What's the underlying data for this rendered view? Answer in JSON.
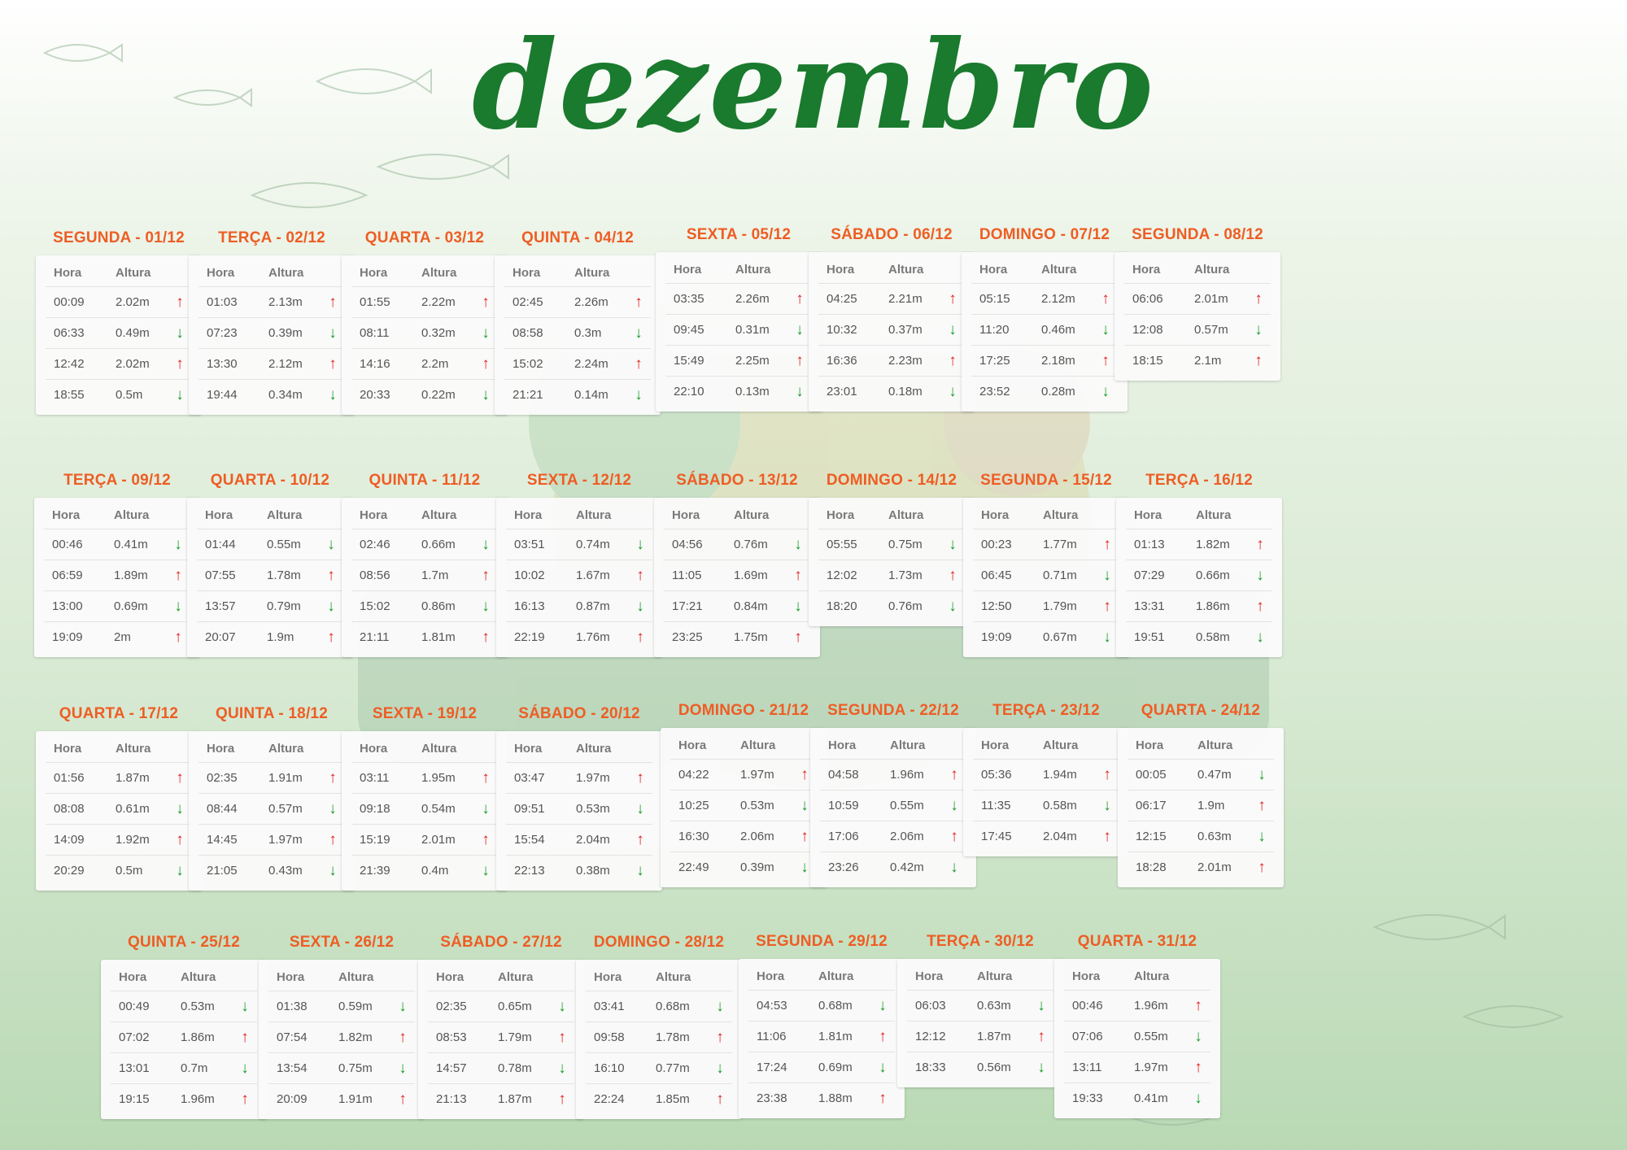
{
  "title": "dezembro",
  "headers": {
    "hora": "Hora",
    "altura": "Altura"
  },
  "colors": {
    "title": "#1a7a2e",
    "day_title": "#ee5d24",
    "up_arrow": "#e02020",
    "down_arrow": "#1c9c2c"
  },
  "icons": {
    "up": "arrow-up-icon",
    "down": "arrow-down-icon"
  },
  "days": [
    {
      "label": "SEGUNDA - 01/12",
      "tides": [
        [
          "00:09",
          "2.02m",
          "up"
        ],
        [
          "06:33",
          "0.49m",
          "down"
        ],
        [
          "12:42",
          "2.02m",
          "up"
        ],
        [
          "18:55",
          "0.5m",
          "down"
        ]
      ]
    },
    {
      "label": "TERÇA - 02/12",
      "tides": [
        [
          "01:03",
          "2.13m",
          "up"
        ],
        [
          "07:23",
          "0.39m",
          "down"
        ],
        [
          "13:30",
          "2.12m",
          "up"
        ],
        [
          "19:44",
          "0.34m",
          "down"
        ]
      ]
    },
    {
      "label": "QUARTA - 03/12",
      "tides": [
        [
          "01:55",
          "2.22m",
          "up"
        ],
        [
          "08:11",
          "0.32m",
          "down"
        ],
        [
          "14:16",
          "2.2m",
          "up"
        ],
        [
          "20:33",
          "0.22m",
          "down"
        ]
      ]
    },
    {
      "label": "QUINTA - 04/12",
      "tides": [
        [
          "02:45",
          "2.26m",
          "up"
        ],
        [
          "08:58",
          "0.3m",
          "down"
        ],
        [
          "15:02",
          "2.24m",
          "up"
        ],
        [
          "21:21",
          "0.14m",
          "down"
        ]
      ]
    },
    {
      "label": "SEXTA - 05/12",
      "tides": [
        [
          "03:35",
          "2.26m",
          "up"
        ],
        [
          "09:45",
          "0.31m",
          "down"
        ],
        [
          "15:49",
          "2.25m",
          "up"
        ],
        [
          "22:10",
          "0.13m",
          "down"
        ]
      ]
    },
    {
      "label": "SÁBADO - 06/12",
      "tides": [
        [
          "04:25",
          "2.21m",
          "up"
        ],
        [
          "10:32",
          "0.37m",
          "down"
        ],
        [
          "16:36",
          "2.23m",
          "up"
        ],
        [
          "23:01",
          "0.18m",
          "down"
        ]
      ]
    },
    {
      "label": "DOMINGO - 07/12",
      "tides": [
        [
          "05:15",
          "2.12m",
          "up"
        ],
        [
          "11:20",
          "0.46m",
          "down"
        ],
        [
          "17:25",
          "2.18m",
          "up"
        ],
        [
          "23:52",
          "0.28m",
          "down"
        ]
      ]
    },
    {
      "label": "SEGUNDA - 08/12",
      "tides": [
        [
          "06:06",
          "2.01m",
          "up"
        ],
        [
          "12:08",
          "0.57m",
          "down"
        ],
        [
          "18:15",
          "2.1m",
          "up"
        ]
      ]
    },
    {
      "label": "TERÇA - 09/12",
      "tides": [
        [
          "00:46",
          "0.41m",
          "down"
        ],
        [
          "06:59",
          "1.89m",
          "up"
        ],
        [
          "13:00",
          "0.69m",
          "down"
        ],
        [
          "19:09",
          "2m",
          "up"
        ]
      ]
    },
    {
      "label": "QUARTA - 10/12",
      "tides": [
        [
          "01:44",
          "0.55m",
          "down"
        ],
        [
          "07:55",
          "1.78m",
          "up"
        ],
        [
          "13:57",
          "0.79m",
          "down"
        ],
        [
          "20:07",
          "1.9m",
          "up"
        ]
      ]
    },
    {
      "label": "QUINTA - 11/12",
      "tides": [
        [
          "02:46",
          "0.66m",
          "down"
        ],
        [
          "08:56",
          "1.7m",
          "up"
        ],
        [
          "15:02",
          "0.86m",
          "down"
        ],
        [
          "21:11",
          "1.81m",
          "up"
        ]
      ]
    },
    {
      "label": "SEXTA - 12/12",
      "tides": [
        [
          "03:51",
          "0.74m",
          "down"
        ],
        [
          "10:02",
          "1.67m",
          "up"
        ],
        [
          "16:13",
          "0.87m",
          "down"
        ],
        [
          "22:19",
          "1.76m",
          "up"
        ]
      ]
    },
    {
      "label": "SÁBADO - 13/12",
      "tides": [
        [
          "04:56",
          "0.76m",
          "down"
        ],
        [
          "11:05",
          "1.69m",
          "up"
        ],
        [
          "17:21",
          "0.84m",
          "down"
        ],
        [
          "23:25",
          "1.75m",
          "up"
        ]
      ]
    },
    {
      "label": "DOMINGO - 14/12",
      "tides": [
        [
          "05:55",
          "0.75m",
          "down"
        ],
        [
          "12:02",
          "1.73m",
          "up"
        ],
        [
          "18:20",
          "0.76m",
          "down"
        ]
      ]
    },
    {
      "label": "SEGUNDA - 15/12",
      "tides": [
        [
          "00:23",
          "1.77m",
          "up"
        ],
        [
          "06:45",
          "0.71m",
          "down"
        ],
        [
          "12:50",
          "1.79m",
          "up"
        ],
        [
          "19:09",
          "0.67m",
          "down"
        ]
      ]
    },
    {
      "label": "TERÇA - 16/12",
      "tides": [
        [
          "01:13",
          "1.82m",
          "up"
        ],
        [
          "07:29",
          "0.66m",
          "down"
        ],
        [
          "13:31",
          "1.86m",
          "up"
        ],
        [
          "19:51",
          "0.58m",
          "down"
        ]
      ]
    },
    {
      "label": "QUARTA - 17/12",
      "tides": [
        [
          "01:56",
          "1.87m",
          "up"
        ],
        [
          "08:08",
          "0.61m",
          "down"
        ],
        [
          "14:09",
          "1.92m",
          "up"
        ],
        [
          "20:29",
          "0.5m",
          "down"
        ]
      ]
    },
    {
      "label": "QUINTA - 18/12",
      "tides": [
        [
          "02:35",
          "1.91m",
          "up"
        ],
        [
          "08:44",
          "0.57m",
          "down"
        ],
        [
          "14:45",
          "1.97m",
          "up"
        ],
        [
          "21:05",
          "0.43m",
          "down"
        ]
      ]
    },
    {
      "label": "SEXTA - 19/12",
      "tides": [
        [
          "03:11",
          "1.95m",
          "up"
        ],
        [
          "09:18",
          "0.54m",
          "down"
        ],
        [
          "15:19",
          "2.01m",
          "up"
        ],
        [
          "21:39",
          "0.4m",
          "down"
        ]
      ]
    },
    {
      "label": "SÁBADO - 20/12",
      "tides": [
        [
          "03:47",
          "1.97m",
          "up"
        ],
        [
          "09:51",
          "0.53m",
          "down"
        ],
        [
          "15:54",
          "2.04m",
          "up"
        ],
        [
          "22:13",
          "0.38m",
          "down"
        ]
      ]
    },
    {
      "label": "DOMINGO - 21/12",
      "tides": [
        [
          "04:22",
          "1.97m",
          "up"
        ],
        [
          "10:25",
          "0.53m",
          "down"
        ],
        [
          "16:30",
          "2.06m",
          "up"
        ],
        [
          "22:49",
          "0.39m",
          "down"
        ]
      ]
    },
    {
      "label": "SEGUNDA - 22/12",
      "tides": [
        [
          "04:58",
          "1.96m",
          "up"
        ],
        [
          "10:59",
          "0.55m",
          "down"
        ],
        [
          "17:06",
          "2.06m",
          "up"
        ],
        [
          "23:26",
          "0.42m",
          "down"
        ]
      ]
    },
    {
      "label": "TERÇA - 23/12",
      "tides": [
        [
          "05:36",
          "1.94m",
          "up"
        ],
        [
          "11:35",
          "0.58m",
          "down"
        ],
        [
          "17:45",
          "2.04m",
          "up"
        ]
      ]
    },
    {
      "label": "QUARTA - 24/12",
      "tides": [
        [
          "00:05",
          "0.47m",
          "down"
        ],
        [
          "06:17",
          "1.9m",
          "up"
        ],
        [
          "12:15",
          "0.63m",
          "down"
        ],
        [
          "18:28",
          "2.01m",
          "up"
        ]
      ]
    },
    {
      "label": "QUINTA - 25/12",
      "tides": [
        [
          "00:49",
          "0.53m",
          "down"
        ],
        [
          "07:02",
          "1.86m",
          "up"
        ],
        [
          "13:01",
          "0.7m",
          "down"
        ],
        [
          "19:15",
          "1.96m",
          "up"
        ]
      ]
    },
    {
      "label": "SEXTA - 26/12",
      "tides": [
        [
          "01:38",
          "0.59m",
          "down"
        ],
        [
          "07:54",
          "1.82m",
          "up"
        ],
        [
          "13:54",
          "0.75m",
          "down"
        ],
        [
          "20:09",
          "1.91m",
          "up"
        ]
      ]
    },
    {
      "label": "SÁBADO - 27/12",
      "tides": [
        [
          "02:35",
          "0.65m",
          "down"
        ],
        [
          "08:53",
          "1.79m",
          "up"
        ],
        [
          "14:57",
          "0.78m",
          "down"
        ],
        [
          "21:13",
          "1.87m",
          "up"
        ]
      ]
    },
    {
      "label": "DOMINGO - 28/12",
      "tides": [
        [
          "03:41",
          "0.68m",
          "down"
        ],
        [
          "09:58",
          "1.78m",
          "up"
        ],
        [
          "16:10",
          "0.77m",
          "down"
        ],
        [
          "22:24",
          "1.85m",
          "up"
        ]
      ]
    },
    {
      "label": "SEGUNDA - 29/12",
      "tides": [
        [
          "04:53",
          "0.68m",
          "down"
        ],
        [
          "11:06",
          "1.81m",
          "up"
        ],
        [
          "17:24",
          "0.69m",
          "down"
        ],
        [
          "23:38",
          "1.88m",
          "up"
        ]
      ]
    },
    {
      "label": "TERÇA - 30/12",
      "tides": [
        [
          "06:03",
          "0.63m",
          "down"
        ],
        [
          "12:12",
          "1.87m",
          "up"
        ],
        [
          "18:33",
          "0.56m",
          "down"
        ]
      ]
    },
    {
      "label": "QUARTA - 31/12",
      "tides": [
        [
          "00:46",
          "1.96m",
          "up"
        ],
        [
          "07:06",
          "0.55m",
          "down"
        ],
        [
          "13:11",
          "1.97m",
          "up"
        ],
        [
          "19:33",
          "0.41m",
          "down"
        ]
      ]
    }
  ]
}
